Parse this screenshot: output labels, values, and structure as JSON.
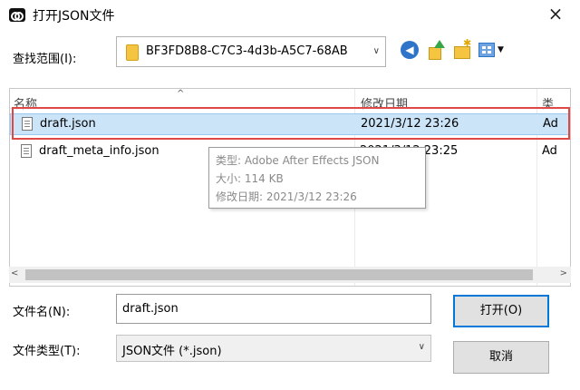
{
  "window": {
    "title": "打开JSON文件",
    "close_glyph": "×"
  },
  "lookin": {
    "label": "查找范围(I):",
    "value": "BF3FD8B8-C7C3-4d3b-A5C7-68AB",
    "arrow": "∨"
  },
  "toolbar": {
    "back_glyph": "◀",
    "view_dropdown_glyph": "▼"
  },
  "list": {
    "columns": [
      "名称",
      "修改日期",
      "类"
    ],
    "sort_glyph": "^",
    "rows": [
      {
        "name": "draft.json",
        "modified": "2021/3/12 23:26",
        "type": "Ad",
        "selected": true
      },
      {
        "name": "draft_meta_info.json",
        "modified": "2021/3/12 23:25",
        "type": "Ad",
        "selected": false
      }
    ]
  },
  "tooltip": {
    "type_line": "类型: Adobe After Effects JSON",
    "size_line": "大小: 114 KB",
    "date_line": "修改日期: 2021/3/12 23:26"
  },
  "scrollbar": {
    "left_glyph": "<",
    "right_glyph": ">"
  },
  "filename": {
    "label": "文件名(N):",
    "value": "draft.json"
  },
  "filetype": {
    "label": "文件类型(T):",
    "value": "JSON文件 (*.json)",
    "arrow": "∨"
  },
  "buttons": {
    "open": "打开(O)",
    "cancel": "取消"
  },
  "colors": {
    "selection": "#cce4f7",
    "highlight": "#e04848",
    "accent": "#0078d7"
  }
}
